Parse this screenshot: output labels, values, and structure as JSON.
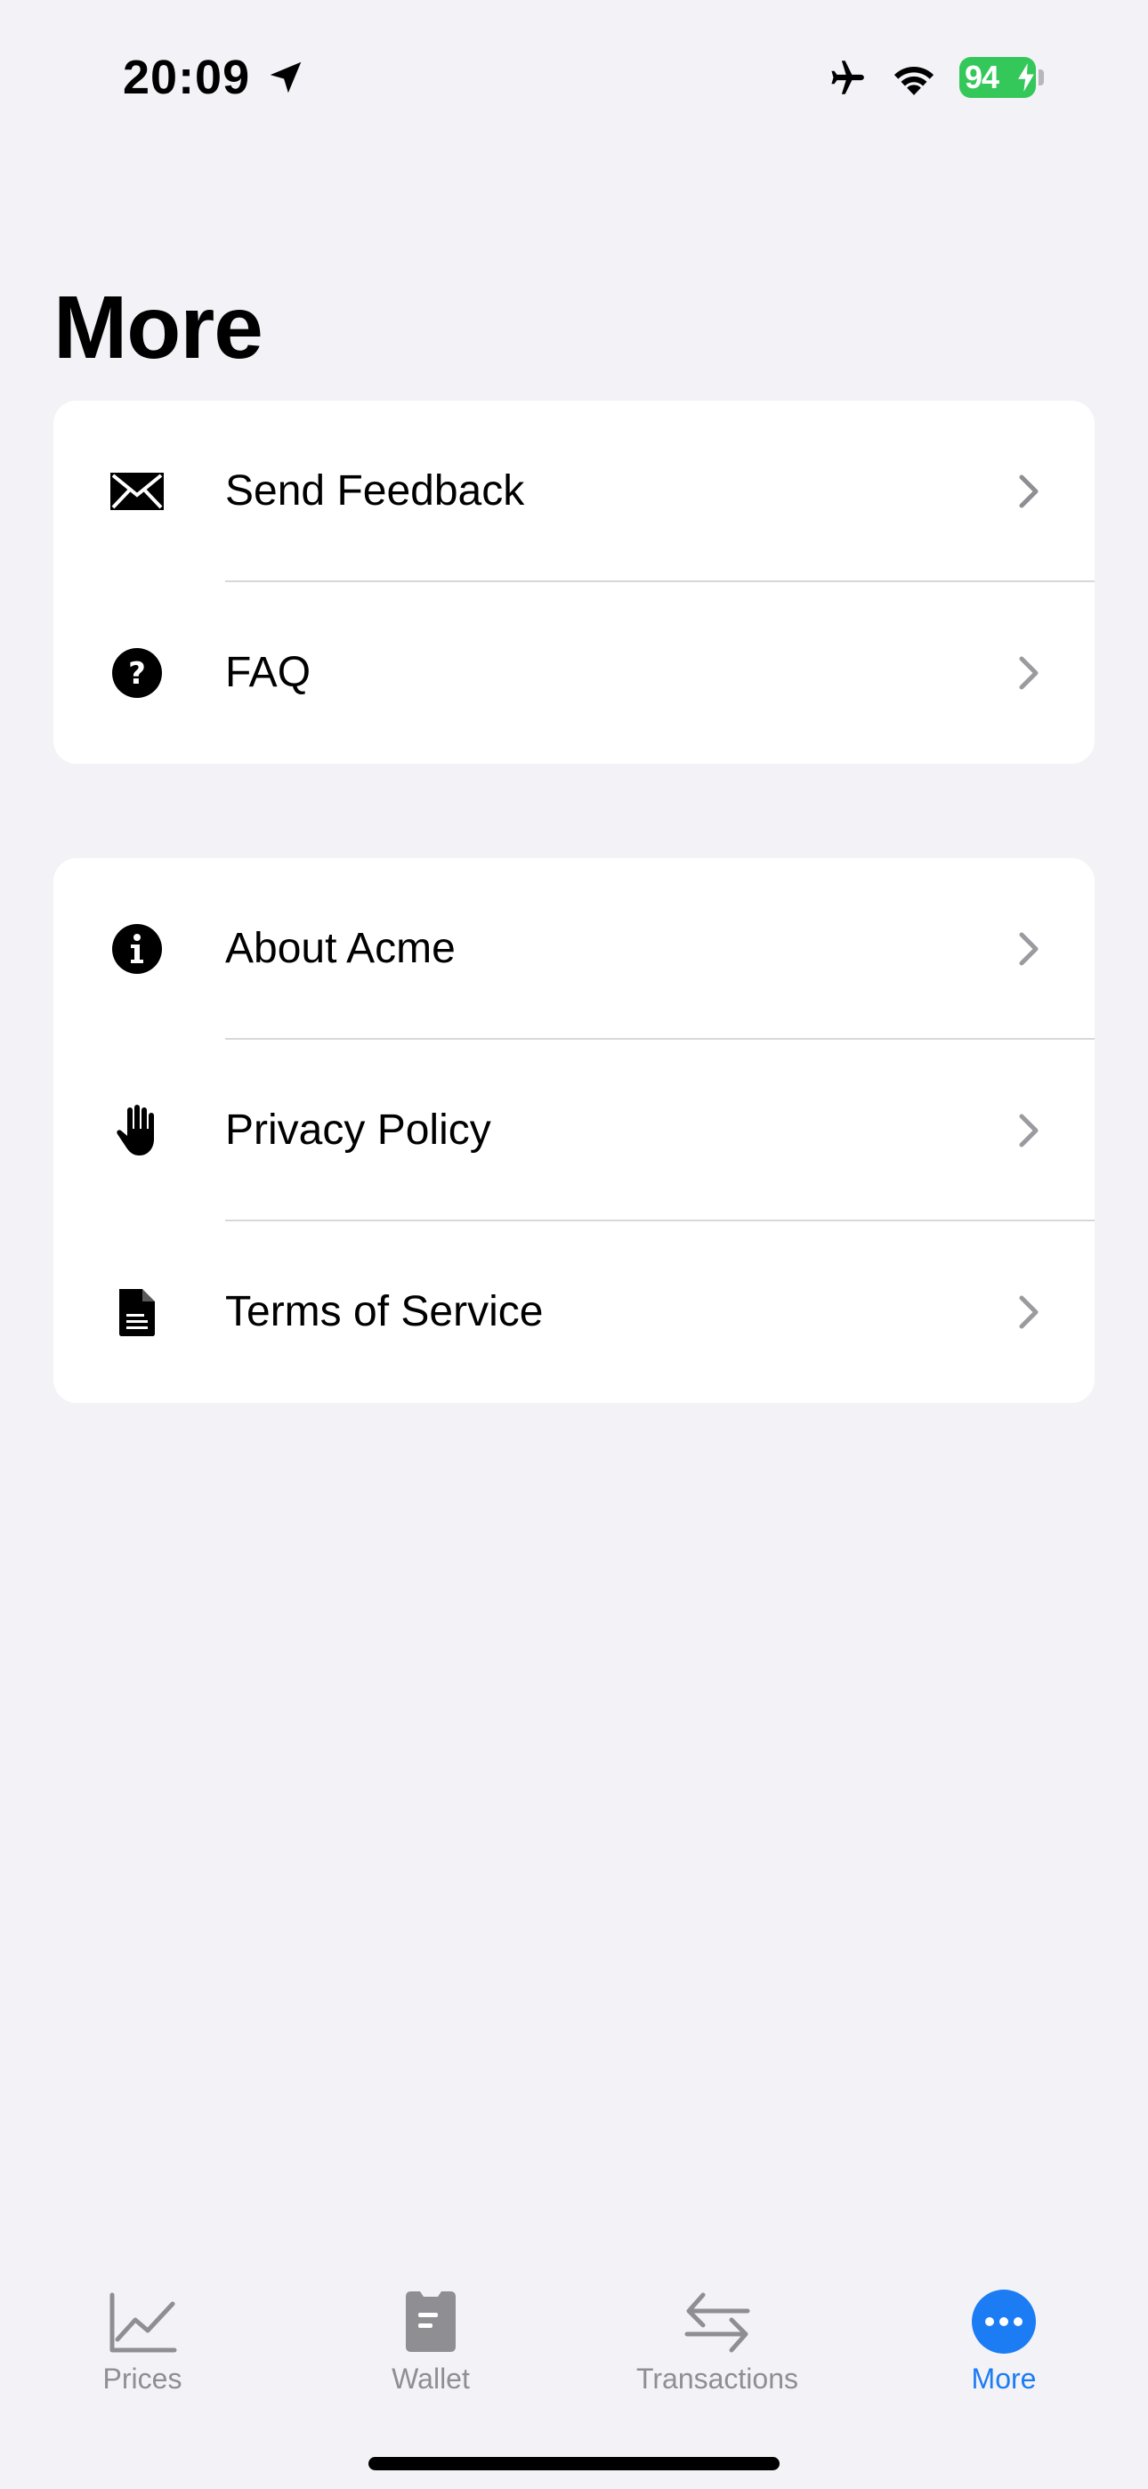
{
  "status_bar": {
    "time": "20:09",
    "battery_percent": "94",
    "icons": [
      "location-arrow-icon",
      "airplane-icon",
      "wifi-icon",
      "battery-icon"
    ],
    "battery_color": "#34C759"
  },
  "page": {
    "title": "More"
  },
  "groups": [
    {
      "items": [
        {
          "label": "Send Feedback",
          "icon": "envelope-icon"
        },
        {
          "label": "FAQ",
          "icon": "question-circle-icon"
        }
      ]
    },
    {
      "items": [
        {
          "label": "About Acme",
          "icon": "info-circle-icon"
        },
        {
          "label": "Privacy Policy",
          "icon": "hand-raised-icon"
        },
        {
          "label": "Terms of Service",
          "icon": "document-icon"
        }
      ]
    }
  ],
  "tab_bar": {
    "tabs": [
      {
        "label": "Prices",
        "icon": "chart-line-icon",
        "active": false
      },
      {
        "label": "Wallet",
        "icon": "wallet-icon",
        "active": false
      },
      {
        "label": "Transactions",
        "icon": "arrows-exchange-icon",
        "active": false
      },
      {
        "label": "More",
        "icon": "ellipsis-circle-icon",
        "active": true
      }
    ],
    "active_color": "#1C7CF4",
    "inactive_color": "#8E8E93"
  },
  "theme": {
    "background": "#F2F2F7",
    "card_background": "#FFFFFF",
    "chevron_color": "#9A9A9F"
  }
}
